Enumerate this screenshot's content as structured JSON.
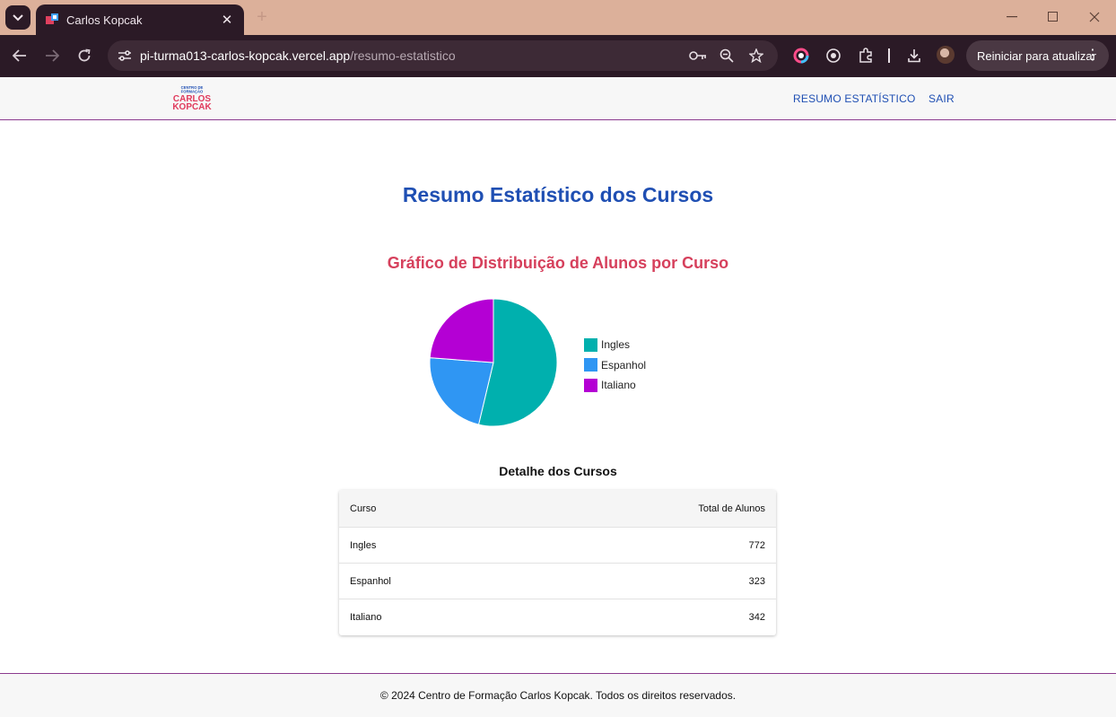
{
  "browser": {
    "tab_title": "Carlos Kopcak",
    "url_host": "pi-turma013-carlos-kopcak.vercel.app",
    "url_path": "/resumo-estatistico",
    "update_button": "Reiniciar para atualizar"
  },
  "header": {
    "logo_line1": "CENTRO DE",
    "logo_line2": "FORMAÇÃO",
    "logo_line3": "CARLOS",
    "logo_line4": "KOPCAK",
    "nav": [
      {
        "label": "RESUMO ESTATÍSTICO"
      },
      {
        "label": "SAIR"
      }
    ]
  },
  "main": {
    "title": "Resumo Estatístico dos Cursos",
    "chart_title": "Gráfico de Distribuição de Alunos por Curso",
    "table_title": "Detalhe dos Cursos",
    "table": {
      "headers": [
        "Curso",
        "Total de Alunos"
      ],
      "rows": [
        [
          "Ingles",
          "772"
        ],
        [
          "Espanhol",
          "323"
        ],
        [
          "Italiano",
          "342"
        ]
      ]
    }
  },
  "chart_data": {
    "type": "pie",
    "categories": [
      "Ingles",
      "Espanhol",
      "Italiano"
    ],
    "values": [
      772,
      323,
      342
    ],
    "colors": [
      "#00b0ae",
      "#2f96f3",
      "#b400d4"
    ],
    "title": "Gráfico de Distribuição de Alunos por Curso",
    "legend_position": "right"
  },
  "footer": {
    "text": "© 2024 Centro de Formação Carlos Kopcak. Todos os direitos reservados."
  }
}
